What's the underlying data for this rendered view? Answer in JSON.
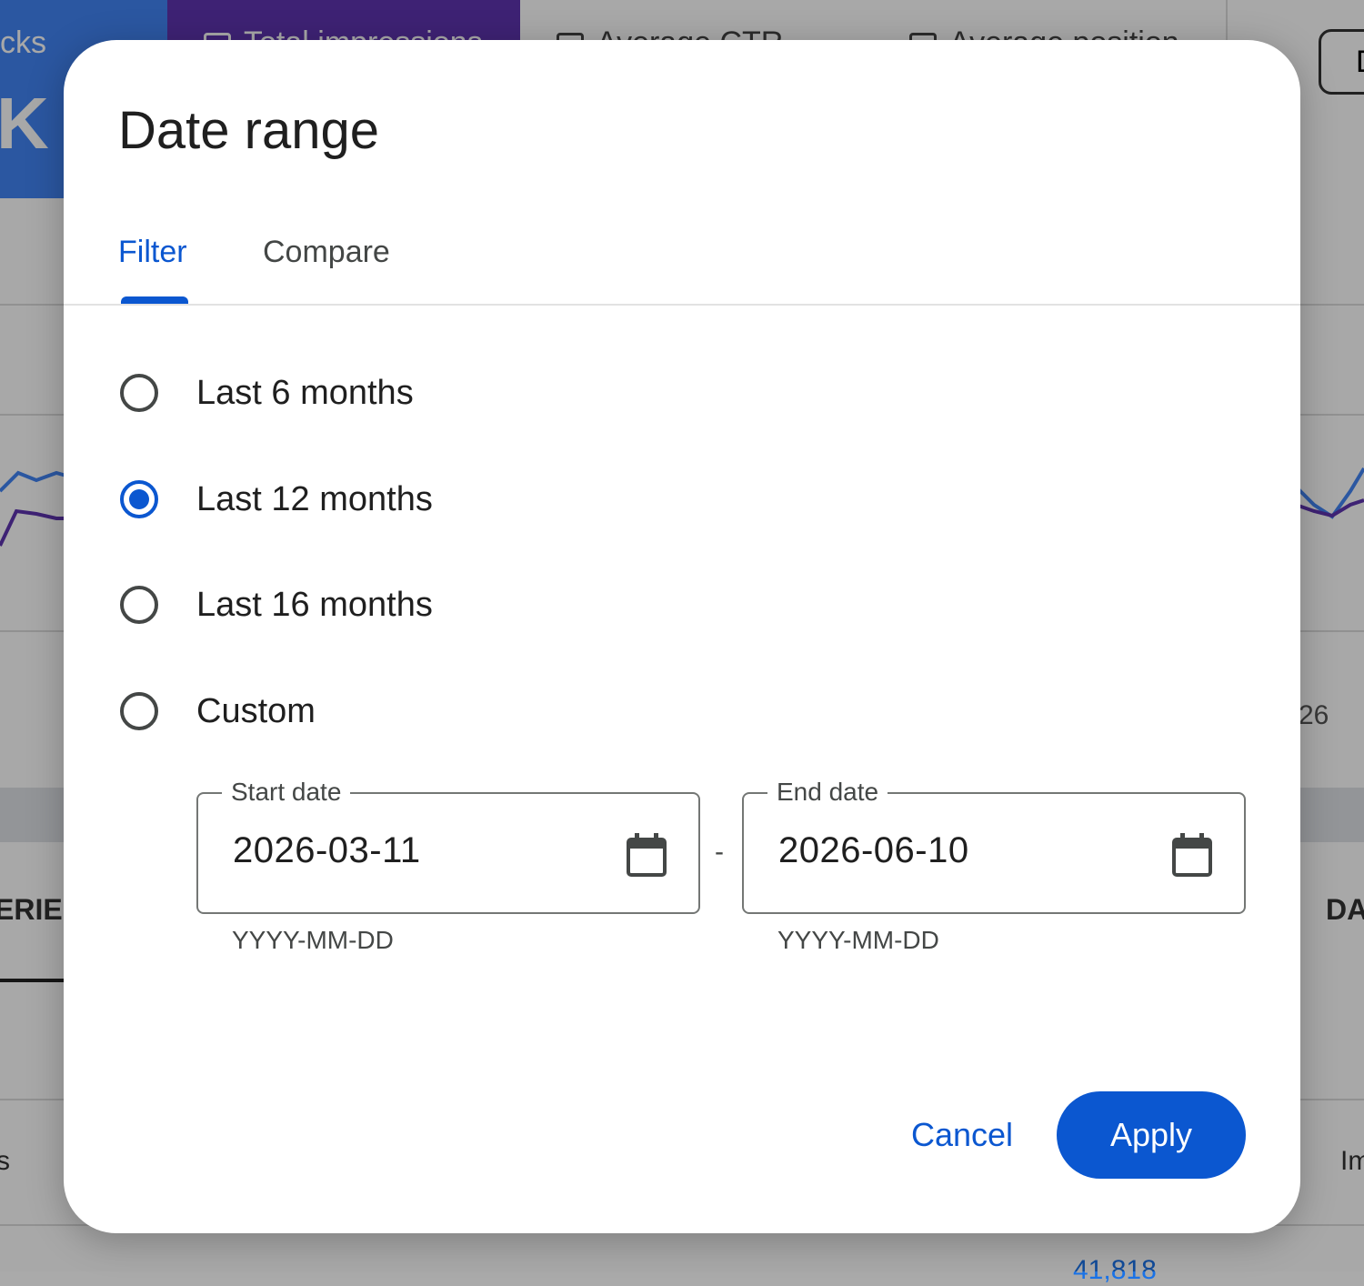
{
  "background": {
    "metric_cards": {
      "clicks_label": "cks",
      "clicks_value": "K",
      "impressions_label": "Total impressions",
      "ctr_label": "Average CTR",
      "position_label": "Average position"
    },
    "top_right_button": "D",
    "axis_label": "26",
    "tab_queries": "ERIE",
    "tab_dates": "DA",
    "col_left": "s",
    "col_right": "Im",
    "bottom_number": "41,818",
    "series_colors": {
      "clicks": "#4285f4",
      "impressions": "#5e35b1"
    }
  },
  "dialog": {
    "title": "Date range",
    "tabs": [
      {
        "label": "Filter",
        "active": true
      },
      {
        "label": "Compare",
        "active": false
      }
    ],
    "options": [
      {
        "label": "Last 6 months",
        "selected": false
      },
      {
        "label": "Last 12 months",
        "selected": true
      },
      {
        "label": "Last 16 months",
        "selected": false
      },
      {
        "label": "Custom",
        "selected": false
      }
    ],
    "start_date": {
      "legend": "Start date",
      "value": "2026-03-11",
      "hint": "YYYY-MM-DD",
      "icon": "calendar-icon"
    },
    "separator": "-",
    "end_date": {
      "legend": "End date",
      "value": "2026-06-10",
      "hint": "YYYY-MM-DD",
      "icon": "calendar-icon"
    },
    "cancel_label": "Cancel",
    "apply_label": "Apply",
    "accent_color": "#0b57d0"
  }
}
